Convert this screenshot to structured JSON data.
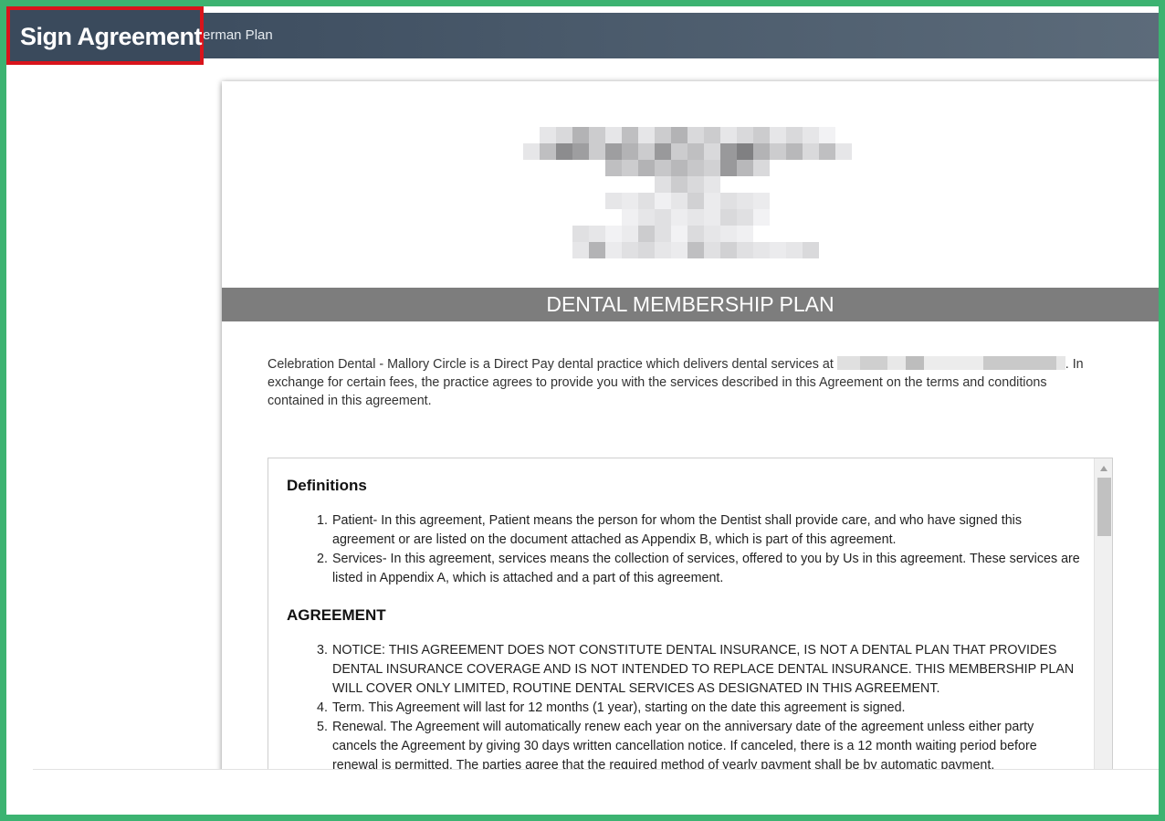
{
  "header": {
    "title": "Sign Agreement",
    "crumb": "erman Plan"
  },
  "document": {
    "banner": "DENTAL MEMBERSHIP PLAN",
    "intro_before": "Celebration Dental - Mallory Circle is a Direct Pay dental practice which delivers dental services at ",
    "intro_after": ". In exchange for certain fees, the practice agrees to provide you with the services described in this Agreement on the terms and conditions contained in this agreement.",
    "sections": [
      {
        "heading": "Definitions",
        "items": [
          {
            "num": "1.",
            "text": "Patient- In this agreement, Patient means the person for whom the Dentist shall provide care, and who have signed this agreement or are listed on the document attached as Appendix B, which is part of this agreement."
          },
          {
            "num": "2.",
            "text": "Services- In this agreement, services means the collection of services, offered to you by Us in this agreement. These services are listed in Appendix A, which is attached and a part of this agreement."
          }
        ]
      },
      {
        "heading": "AGREEMENT",
        "items": [
          {
            "num": "3.",
            "text": "NOTICE: THIS AGREEMENT DOES NOT CONSTITUTE DENTAL INSURANCE, IS NOT A DENTAL PLAN THAT PROVIDES DENTAL INSURANCE COVERAGE AND IS NOT INTENDED TO REPLACE DENTAL INSURANCE. THIS MEMBERSHIP PLAN WILL COVER ONLY LIMITED, ROUTINE DENTAL SERVICES AS DESIGNATED IN THIS AGREEMENT."
          },
          {
            "num": "4.",
            "text": "Term. This Agreement will last for 12 months (1 year), starting on the date this agreement is signed."
          },
          {
            "num": "5.",
            "text": "Renewal. The Agreement will automatically renew each year on the anniversary date of the agreement unless either party cancels the Agreement by giving 30 days written cancellation notice. If canceled, there is a 12 month waiting period before renewal is permitted. The parties agree that the required method of yearly payment shall be by automatic payment."
          }
        ]
      }
    ]
  },
  "colors": {
    "outer_border": "#3cb371",
    "highlight": "#d9141b",
    "topbar": "#37475a",
    "banner": "#7d7d7d"
  }
}
